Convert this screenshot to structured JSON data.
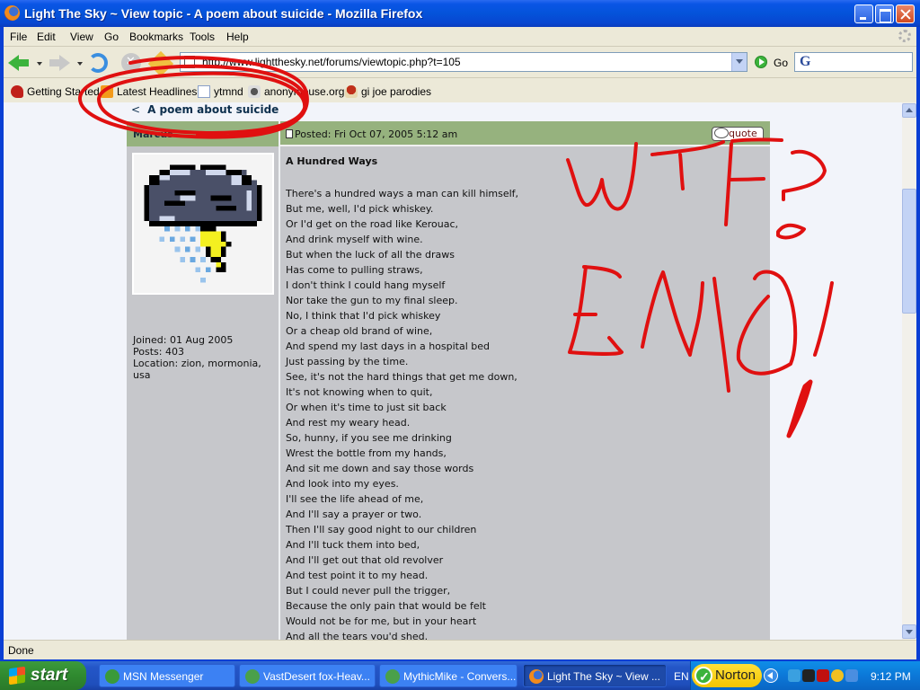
{
  "window": {
    "title": "Light The Sky ~ View topic - A poem about suicide - Mozilla Firefox"
  },
  "menu": [
    "File",
    "Edit",
    "View",
    "Go",
    "Bookmarks",
    "Tools",
    "Help"
  ],
  "navbar": {
    "url": "http://www.lightthesky.net/forums/viewtopic.php?t=105",
    "go_label": "Go",
    "search_value": ""
  },
  "bookmarks": [
    {
      "label": "Getting Started",
      "icon": "firefox-start-icon"
    },
    {
      "label": "Latest Headlines",
      "icon": "rss-feed-icon"
    },
    {
      "label": "ytmnd",
      "icon": "page-icon"
    },
    {
      "label": "anonymouse.org",
      "icon": "skull-icon"
    },
    {
      "label": "gi joe parodies",
      "icon": "mushroom-icon"
    }
  ],
  "page": {
    "topic_back": "<",
    "topic_title": "A poem about suicide",
    "post": {
      "author": "Marcus",
      "posted": "Posted: Fri Oct 07, 2005 5:12 am",
      "quote_label": "quote",
      "profile": {
        "joined": "Joined: 01 Aug 2005",
        "posts": "Posts: 403",
        "location": "Location: zion, mormonia, usa"
      },
      "title": "A Hundred Ways",
      "lines": [
        "There's a hundred ways a man can kill himself,",
        "But me, well, I'd pick whiskey.",
        "Or I'd get on the road like Kerouac,",
        "And drink myself with wine.",
        "But when the luck of all the draws",
        "Has come to pulling straws,",
        "I don't think I could hang myself",
        "Nor take the gun to my final sleep.",
        "No, I think that I'd pick whiskey",
        "Or a cheap old brand of wine,",
        "And spend my last days in a hospital bed",
        "Just passing by the time.",
        "See, it's not the hard things that get me down,",
        "It's not knowing when to quit,",
        "Or when it's time to just sit back",
        "And rest my weary head.",
        "So, hunny, if you see me drinking",
        "Wrest the bottle from my hands,",
        "And sit me down and say those words",
        "And look into my eyes.",
        "I'll see the life ahead of me,",
        "And I'll say a prayer or two.",
        "Then I'll say good night to our children",
        "And I'll tuck them into bed,",
        "And I'll get out that old revolver",
        "And test point it to my head.",
        "But I could never pull the trigger,",
        "Because the only pain that would be felt",
        "Would not be for me, but in your heart",
        "And all the tears you'd shed."
      ]
    },
    "annotation": {
      "text_1": "WTF?",
      "text_2": "EMO!",
      "color": "#e01010"
    }
  },
  "status": "Done",
  "taskbar": {
    "start_label": "start",
    "tasks": [
      {
        "label": "MSN Messenger",
        "active": false
      },
      {
        "label": "VastDesert fox-Heav...",
        "active": false
      },
      {
        "label": "MythicMike - Convers...",
        "active": false
      },
      {
        "label": "Light The Sky ~ View ...",
        "active": true
      }
    ],
    "language": "EN",
    "norton_label": "Norton",
    "clock": "9:12 PM"
  },
  "colors": {
    "post_header": "#96b27e",
    "post_body": "#c6c7cb",
    "page_bg": "#f2f4fa",
    "topic_link": "#0d2f4d"
  }
}
